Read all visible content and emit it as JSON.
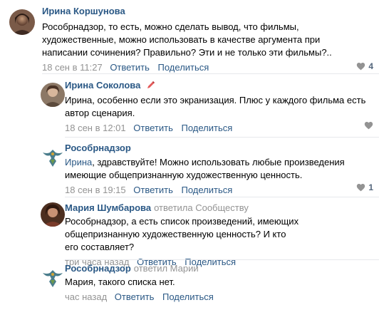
{
  "icons": {
    "like": "heart-icon",
    "edit": "pencil-icon"
  },
  "colors": {
    "link": "#2a5885",
    "meta": "#939393",
    "separator": "#e7e8ec"
  },
  "actions": {
    "reply": "Ответить",
    "share": "Поделиться"
  },
  "comments": [
    {
      "author": "Ирина Коршунова",
      "replied_to": "",
      "mention": "",
      "text": "Рособрнадзор, то есть, можно сделать вывод, что фильмы, художественные, можно использовать в качестве аргумента при написании сочинения? Правильно? Эти и не только эти фильмы?..",
      "date": "18 сен в 11:27",
      "likes": "4"
    },
    {
      "author": "Ирина Соколова",
      "replied_to": "",
      "mention": "",
      "text": "Ирина, особенно если это экранизация. Плюс у каждого фильма есть автор сценария.",
      "date": "18 сен в 12:01",
      "likes": ""
    },
    {
      "author": "Рособрнадзор",
      "replied_to": "",
      "mention": "Ирина",
      "text": ", здравствуйте! Можно использовать любые произведения имеющие общепризнанную художественную ценность.",
      "date": "18 сен в 19:15",
      "likes": "1"
    },
    {
      "author": "Мария Шумбарова",
      "replied_to": "ответила Сообществу",
      "mention": "",
      "text": "Рособрнадзор, а есть список произведений, имеющих общепризнанную художественную ценность? И кто его составляет?",
      "date": "три часа назад",
      "likes": ""
    },
    {
      "author": "Рособрнадзор",
      "replied_to": "ответил Марии",
      "mention": "",
      "text": "Мария, такого списка нет.",
      "date": "час назад",
      "likes": ""
    }
  ]
}
